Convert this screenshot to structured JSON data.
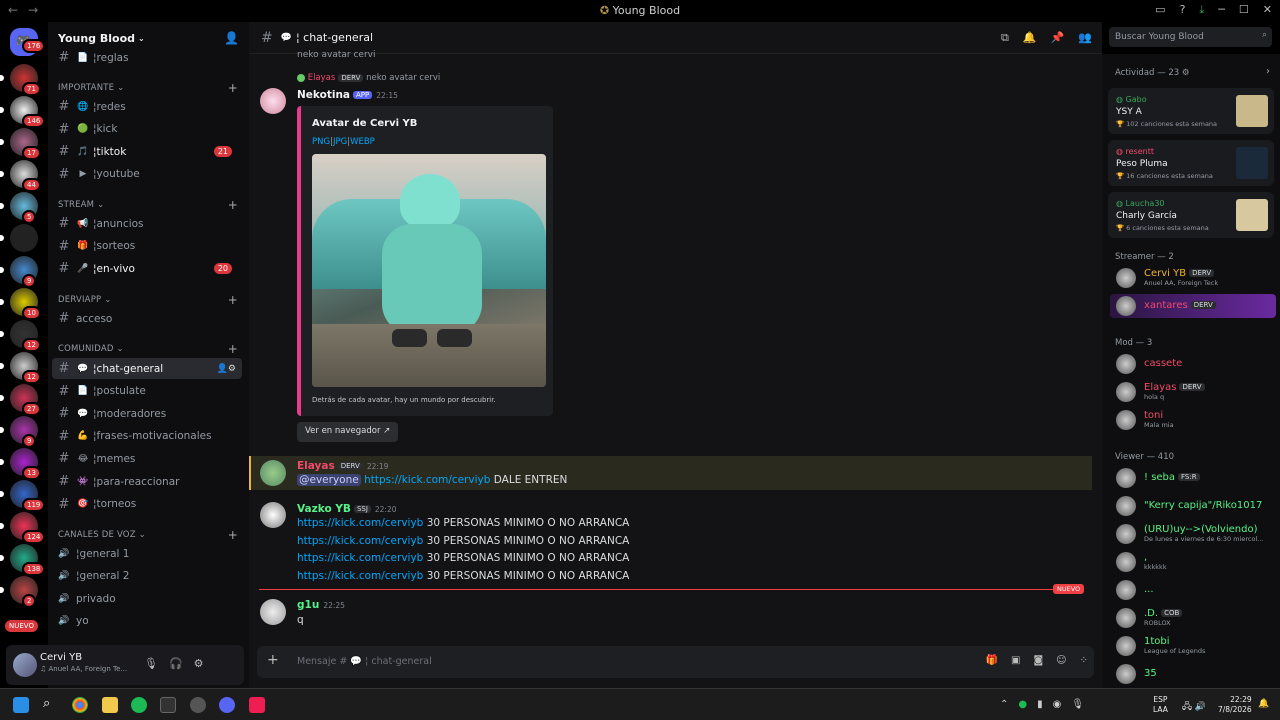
{
  "window": {
    "title": "Young Blood",
    "nav_back": "←",
    "nav_fwd": "→"
  },
  "servers": {
    "home_badge": "176",
    "badges": [
      "71",
      "146",
      "17",
      "44",
      "5",
      "",
      "9",
      "10",
      "12",
      "12",
      "27",
      "9",
      "13",
      "119",
      "124",
      "138",
      "2"
    ],
    "new_label": "NUEVO"
  },
  "guild": {
    "name": "Young Blood"
  },
  "channels": {
    "top": [
      {
        "name": "reglas"
      }
    ],
    "categories": [
      {
        "name": "IMPORTANTE"
      },
      {
        "name": "STREAM"
      },
      {
        "name": "DERVIAPP"
      },
      {
        "name": "COMUNIDAD"
      },
      {
        "name": "Canales de voz"
      }
    ],
    "importante": [
      {
        "name": "redes"
      },
      {
        "name": "kick"
      },
      {
        "name": "tiktok",
        "badge": "21"
      },
      {
        "name": "youtube"
      }
    ],
    "stream": [
      {
        "name": "anuncios"
      },
      {
        "name": "sorteos"
      },
      {
        "name": "en-vivo",
        "badge": "20"
      }
    ],
    "derviapp": [
      {
        "name": "acceso"
      }
    ],
    "comunidad": [
      {
        "name": "chat-general"
      },
      {
        "name": "postulate"
      },
      {
        "name": "moderadores"
      },
      {
        "name": "frases-motivacionales"
      },
      {
        "name": "memes"
      },
      {
        "name": "para-reaccionar"
      },
      {
        "name": "torneos"
      }
    ],
    "voz": [
      {
        "name": "general 1"
      },
      {
        "name": "general 2"
      },
      {
        "name": "privado"
      },
      {
        "name": "yo"
      }
    ]
  },
  "user": {
    "name": "Cervi YB",
    "status": "Anuel AA, Foreign Te..."
  },
  "chat": {
    "channel": "chat-general",
    "search_placeholder": "Buscar Young Blood",
    "prev_line": "neko avatar cervi",
    "reply": {
      "user": "Elayas",
      "tag": "DERV",
      "text": "neko avatar cervi"
    },
    "messages": [
      {
        "user": "Nekotina",
        "badge": "APP",
        "time": "22:15",
        "embed": {
          "title": "Avatar de Cervi YB",
          "links": [
            "PNG",
            "JPG",
            "WEBP"
          ],
          "footer": "Detrás de cada avatar, hay un mundo por descubrir."
        },
        "button": "Ver en navegador"
      },
      {
        "user": "Elayas",
        "tag": "DERV",
        "time": "22:19",
        "mention": "@everyone",
        "link": "https://kick.com/cerviyb",
        "text": "DALE ENTREN"
      },
      {
        "user": "Vazko YB",
        "tag": "SSJ",
        "time": "22:20",
        "lines": [
          {
            "link": "https://kick.com/cerviyb",
            "text": "30 PERSONAS MINIMO O NO ARRANCA"
          },
          {
            "link": "https://kick.com/cerviyb",
            "text": "30 PERSONAS MINIMO O NO ARRANCA"
          },
          {
            "link": "https://kick.com/cerviyb",
            "text": "30 PERSONAS MINIMO O NO ARRANCA"
          },
          {
            "link": "https://kick.com/cerviyb",
            "text": "30 PERSONAS MINIMO O NO ARRANCA"
          }
        ]
      },
      {
        "user": "g1u",
        "time": "22:25",
        "text": "q"
      }
    ],
    "new_divider": "NUEVO",
    "composer_placeholder": "Mensaje #",
    "composer_channel": "chat-general"
  },
  "members": {
    "activity_header": "Actividad — 23",
    "activity": [
      {
        "user": "Gabo",
        "song": "YSY A",
        "stat": "102 canciones esta semana"
      },
      {
        "user": "resentt",
        "song": "Peso Pluma",
        "stat": "16 canciones esta semana"
      },
      {
        "user": "Laucha30",
        "song": "Charly García",
        "stat": "6 canciones esta semana"
      }
    ],
    "streamer_header": "Streamer — 2",
    "streamers": [
      {
        "name": "Cervi YB",
        "tag": "DERV",
        "status": "Anuel AA, Foreign Teck"
      },
      {
        "name": "xantares",
        "tag": "DERV",
        "status": ""
      }
    ],
    "mod_header": "Mod — 3",
    "mods": [
      {
        "name": "cassete",
        "status": ""
      },
      {
        "name": "Elayas",
        "tag": "DERV",
        "status": "hola q"
      },
      {
        "name": "toni",
        "status": "Mala mia"
      }
    ],
    "viewer_header": "Viewer — 410",
    "viewers": [
      {
        "name": "! seba",
        "tag": "FS:R",
        "status": ""
      },
      {
        "name": "\"Kerry capija\"/Riko1017",
        "status": ""
      },
      {
        "name": "(URU)uy-->(Volviendo)",
        "status": "De lunes a viernes de 6:30 miercol..."
      },
      {
        "name": ",",
        "status": "kkkkkk"
      },
      {
        "name": "...",
        "status": ""
      },
      {
        "name": ".D.",
        "tag": "COB",
        "status": "ROBLOX"
      },
      {
        "name": "1tobi",
        "status": "League of Legends"
      },
      {
        "name": "35",
        "status": ""
      }
    ]
  },
  "taskbar": {
    "lang": "ESP",
    "lang2": "LAA",
    "time": "22:29",
    "date": "7/8/2026"
  },
  "colors": {
    "accent": "#5865f2",
    "red": "#da373c",
    "link": "#00a8fc",
    "embed_border": "#e93a8e"
  }
}
